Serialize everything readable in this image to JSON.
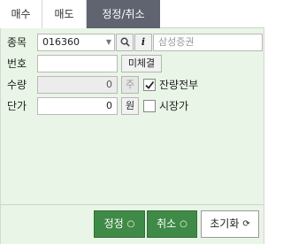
{
  "tabs": [
    {
      "label": "매수"
    },
    {
      "label": "매도"
    },
    {
      "label": "정정/취소"
    }
  ],
  "form": {
    "stock": {
      "label": "종목",
      "code": "016360",
      "name_placeholder": "삼성증권"
    },
    "order_no": {
      "label": "번호",
      "value": "",
      "unfilled_button": "미체결"
    },
    "quantity": {
      "label": "수량",
      "value": "0",
      "unit": "주",
      "all_remaining_label": "잔량전부",
      "all_remaining_checked": true
    },
    "price": {
      "label": "단가",
      "value": "0",
      "unit": "원",
      "market_price_label": "시장가",
      "market_price_checked": false
    }
  },
  "actions": {
    "modify": "정정",
    "cancel": "취소",
    "reset": "초기화"
  },
  "icons": {
    "search": "search-icon",
    "info": "info-icon",
    "dropdown": "chevron-down-icon",
    "spinner": "spinner-icon",
    "refresh": "refresh-icon"
  },
  "colors": {
    "active_tab": "#5f6470",
    "panel_bg": "#e9f5e6",
    "action_green": "#3f8a46"
  }
}
